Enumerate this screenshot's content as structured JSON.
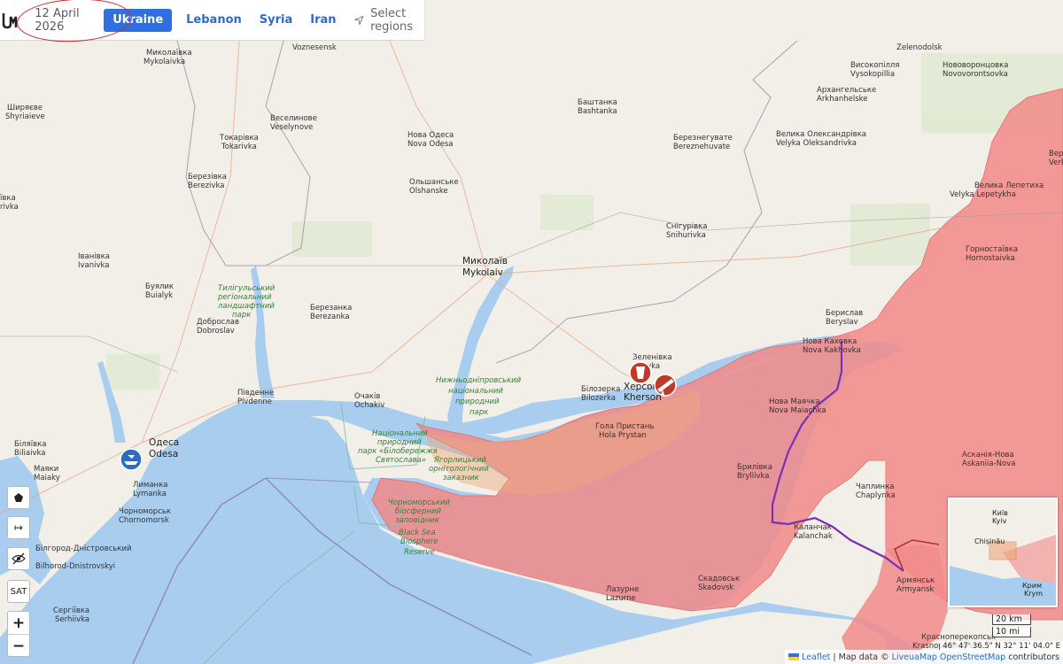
{
  "header": {
    "date": "12 April 2026",
    "tabs": [
      {
        "label": "Ukraine",
        "active": true
      },
      {
        "label": "Lebanon",
        "active": false
      },
      {
        "label": "Syria",
        "active": false
      },
      {
        "label": "Iran",
        "active": false
      }
    ],
    "select_regions": "Select regions"
  },
  "colors": {
    "accent": "#2f6fe0",
    "occupied": "#f28b8b",
    "sea": "#a8cdef",
    "land": "#f2efe9",
    "front_line": "#7a2fb8",
    "annotation": "#d0262b"
  },
  "map_labels": {
    "mykolaiv": [
      "Миколаїв",
      "Mykolaiv"
    ],
    "kherson": [
      "Херсон",
      "Kherson"
    ],
    "odesa": [
      "Одеса",
      "Odesa"
    ],
    "mykolaivka": [
      "Миколаївка",
      "Mykolaivka"
    ],
    "voznesensk": "Voznesensk",
    "shyriaieve": [
      "Ширяєве",
      "Shyriaieve"
    ],
    "veselynove": [
      "Веселинове",
      "Veselynove"
    ],
    "tokarivka": [
      "Токарівка",
      "Tokarivka"
    ],
    "berezivka": [
      "Березівка",
      "Berezivka"
    ],
    "nova_odesa": [
      "Нова Одеса",
      "Nova Odesa"
    ],
    "olshanske": [
      "Ольшанське",
      "Olshanske"
    ],
    "bashtanka": [
      "Баштанка",
      "Bashtanka"
    ],
    "bereznehuvate": [
      "Березнегувате",
      "Bereznehuvate"
    ],
    "snihurivka": [
      "Снігурівка",
      "Snihurivka"
    ],
    "velyka_oleksandrivka": [
      "Велика Олександрівка",
      "Velyka Oleksandrivka"
    ],
    "arkhanhelske": [
      "Архангельське",
      "Arkhanhelske"
    ],
    "vysokopillia": [
      "Високопілля",
      "Vysokopillia"
    ],
    "novovorontsovka": [
      "Нововоронцовка",
      "Novovorontsovka"
    ],
    "zelenodolsk": [
      "Зеленодольськ",
      "Zelenodolsk"
    ],
    "velyka_lepetykha": [
      "Велика Лепетиха",
      "Velyka Lepetykha"
    ],
    "hornostaivka": [
      "Горностаївка",
      "Hornostaivka"
    ],
    "beryslav": [
      "Берислав",
      "Beryslav"
    ],
    "nova_kakhovka": [
      "Нова Каховка",
      "Nova Kakhovka"
    ],
    "nova_maiachka": [
      "Нова Маячка",
      "Nova Maiachka"
    ],
    "askaniia_nova": [
      "Асканія-Нова",
      "Askaniia-Nova"
    ],
    "chaplynka": [
      "Чаплинка",
      "Chaplynka"
    ],
    "bryllivka": [
      "Брилівка",
      "Bryllivka"
    ],
    "kalanchak": [
      "Каланчак",
      "Kalanchak"
    ],
    "armiansk": [
      "Армянськ",
      "Armyansk"
    ],
    "krasnoperekopsk": [
      "Красноперекопськ",
      "Krasnoperekopsk"
    ],
    "skadovsk": [
      "Скадовськ",
      "Skadovsk"
    ],
    "lazurne": [
      "Лазурне",
      "Lazurne"
    ],
    "hola_prystan": [
      "Гола Пристань",
      "Hola Prystan"
    ],
    "bilozerka": [
      "Білозерка",
      "Bilozerka"
    ],
    "zelenivka": [
      "Зеленівка",
      "...vka"
    ],
    "ochakiv": [
      "Очаків",
      "Ochakiv"
    ],
    "pivdenne": [
      "Південне",
      "Pivdenne"
    ],
    "dobroslav": [
      "Доброслав",
      "Dobroslav"
    ],
    "buialyk": [
      "Буялик",
      "Buialyk"
    ],
    "ivanivka": [
      "Іванівка",
      "Ivanivka"
    ],
    "berezanka": [
      "Березанка",
      "Berezanka"
    ],
    "biliaivka": [
      "Біляївка",
      "Biliaivka"
    ],
    "maiaky": [
      "Маяки",
      "Maiaky"
    ],
    "lymanka": [
      "Лиманка",
      "Lymanka"
    ],
    "chornomorsk": [
      "Чорноморськ",
      "Chornomorsk"
    ],
    "bilhorod": [
      "Білгород-Дністровський",
      "Bilhorod-Dnistrovskyi"
    ],
    "serhiivka": [
      "Сергіївка",
      "Serhiivka"
    ],
    "tylihul_park": [
      "Тилігульський",
      "регіональний",
      "ландшафтний",
      "парк"
    ],
    "nyzhnodniprovskyi_park": [
      "Нижньодніпровський",
      "національний",
      "природний",
      "парк"
    ],
    "biloberezhzhia_park": [
      "Національний",
      "природний",
      "парк «Білобережжя",
      "Святослава»"
    ],
    "yahorlytskyi": [
      "Ягорлицький",
      "орнітологічний",
      "заказник"
    ],
    "black_sea_reserve": [
      "Чорноморський",
      "біосферний",
      "заповідник",
      "Black Sea",
      "Biosphere",
      "Reserve"
    ],
    "edge_right_1": "Верх",
    "edge_right_2": "Verkh",
    "edge_left_1": "ївка",
    "edge_left_2": "rivka"
  },
  "minimap": {
    "labels": [
      "Київ",
      "Kyiv",
      "Chișinău",
      "Крим",
      "Krym"
    ]
  },
  "controls": {
    "sat_label": "SAT",
    "zoom_in": "+",
    "zoom_out": "−",
    "measure_label": "↦"
  },
  "scale": {
    "km": "20 km",
    "mi": "10 mi"
  },
  "coordinates": "46° 47' 36.5\" N 32° 11' 04.0\" E",
  "attribution": {
    "leaflet": "Leaflet",
    "separator": "|",
    "map_data": "Map data ©",
    "liveuamap": "LiveuaMap",
    "osm": "OpenStreetMap",
    "contributors": "contributors"
  }
}
